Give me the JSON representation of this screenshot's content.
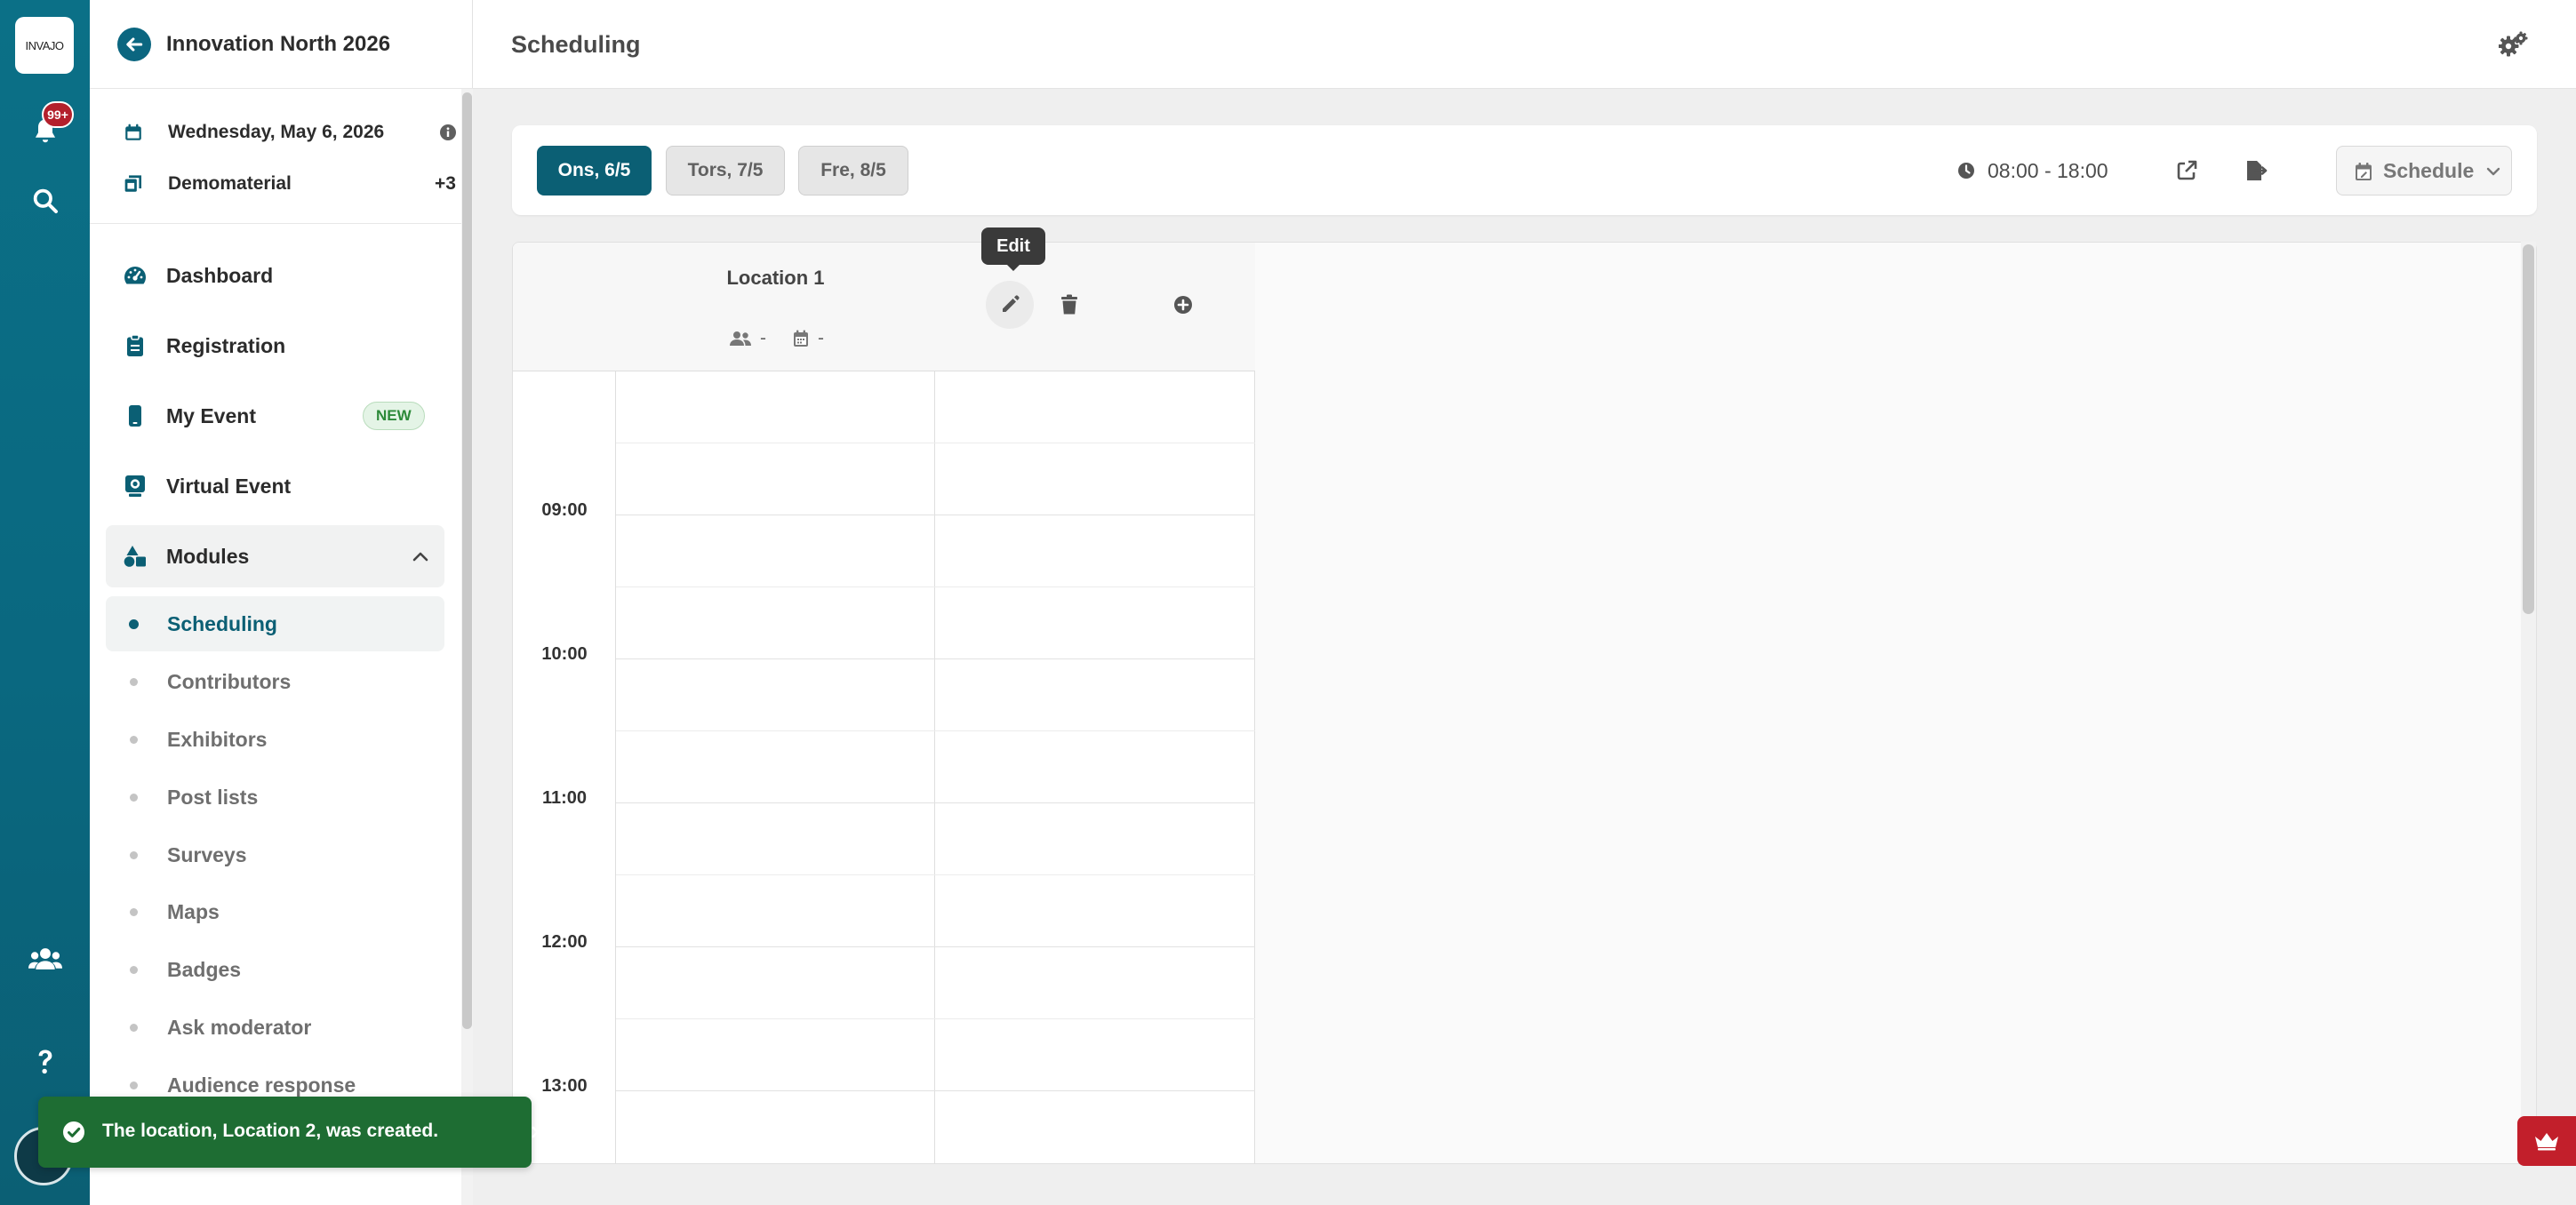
{
  "rail": {
    "logo_text": "INVAJO",
    "notifications_badge": "99+"
  },
  "sidebar": {
    "event_name": "Innovation North 2026",
    "date": "Wednesday, May 6, 2026",
    "material": "Demomaterial",
    "material_more": "+3",
    "nav": [
      {
        "label": "Dashboard",
        "icon": "gauge-icon"
      },
      {
        "label": "Registration",
        "icon": "clipboard-icon"
      },
      {
        "label": "My Event",
        "icon": "phone-icon",
        "badge": "NEW"
      },
      {
        "label": "Virtual Event",
        "icon": "monitor-icon"
      },
      {
        "label": "Modules",
        "icon": "shapes-icon"
      }
    ],
    "modules": [
      {
        "label": "Scheduling"
      },
      {
        "label": "Contributors"
      },
      {
        "label": "Exhibitors"
      },
      {
        "label": "Post lists"
      },
      {
        "label": "Surveys"
      },
      {
        "label": "Maps"
      },
      {
        "label": "Badges"
      },
      {
        "label": "Ask moderator"
      },
      {
        "label": "Audience response"
      }
    ]
  },
  "header": {
    "title": "Scheduling"
  },
  "daybar": {
    "days": [
      {
        "label": "Ons, 6/5",
        "active": true
      },
      {
        "label": "Tors, 7/5",
        "active": false
      },
      {
        "label": "Fre, 8/5",
        "active": false
      }
    ],
    "time_range": "08:00 - 18:00",
    "view_select": "Schedule"
  },
  "calendar": {
    "location_name": "Location 1",
    "participants": "-",
    "sessions": "-",
    "tooltip": "Edit",
    "hours": [
      "09:00",
      "10:00",
      "11:00",
      "12:00",
      "13:00"
    ]
  },
  "toast": {
    "message": "The location, Location 2, was created."
  },
  "colors": {
    "brand": "#0b5f74",
    "rail": "#0a6880",
    "toast": "#1e6d33",
    "badge_red": "#b3202c",
    "new_badge": "#2d8a3a"
  }
}
